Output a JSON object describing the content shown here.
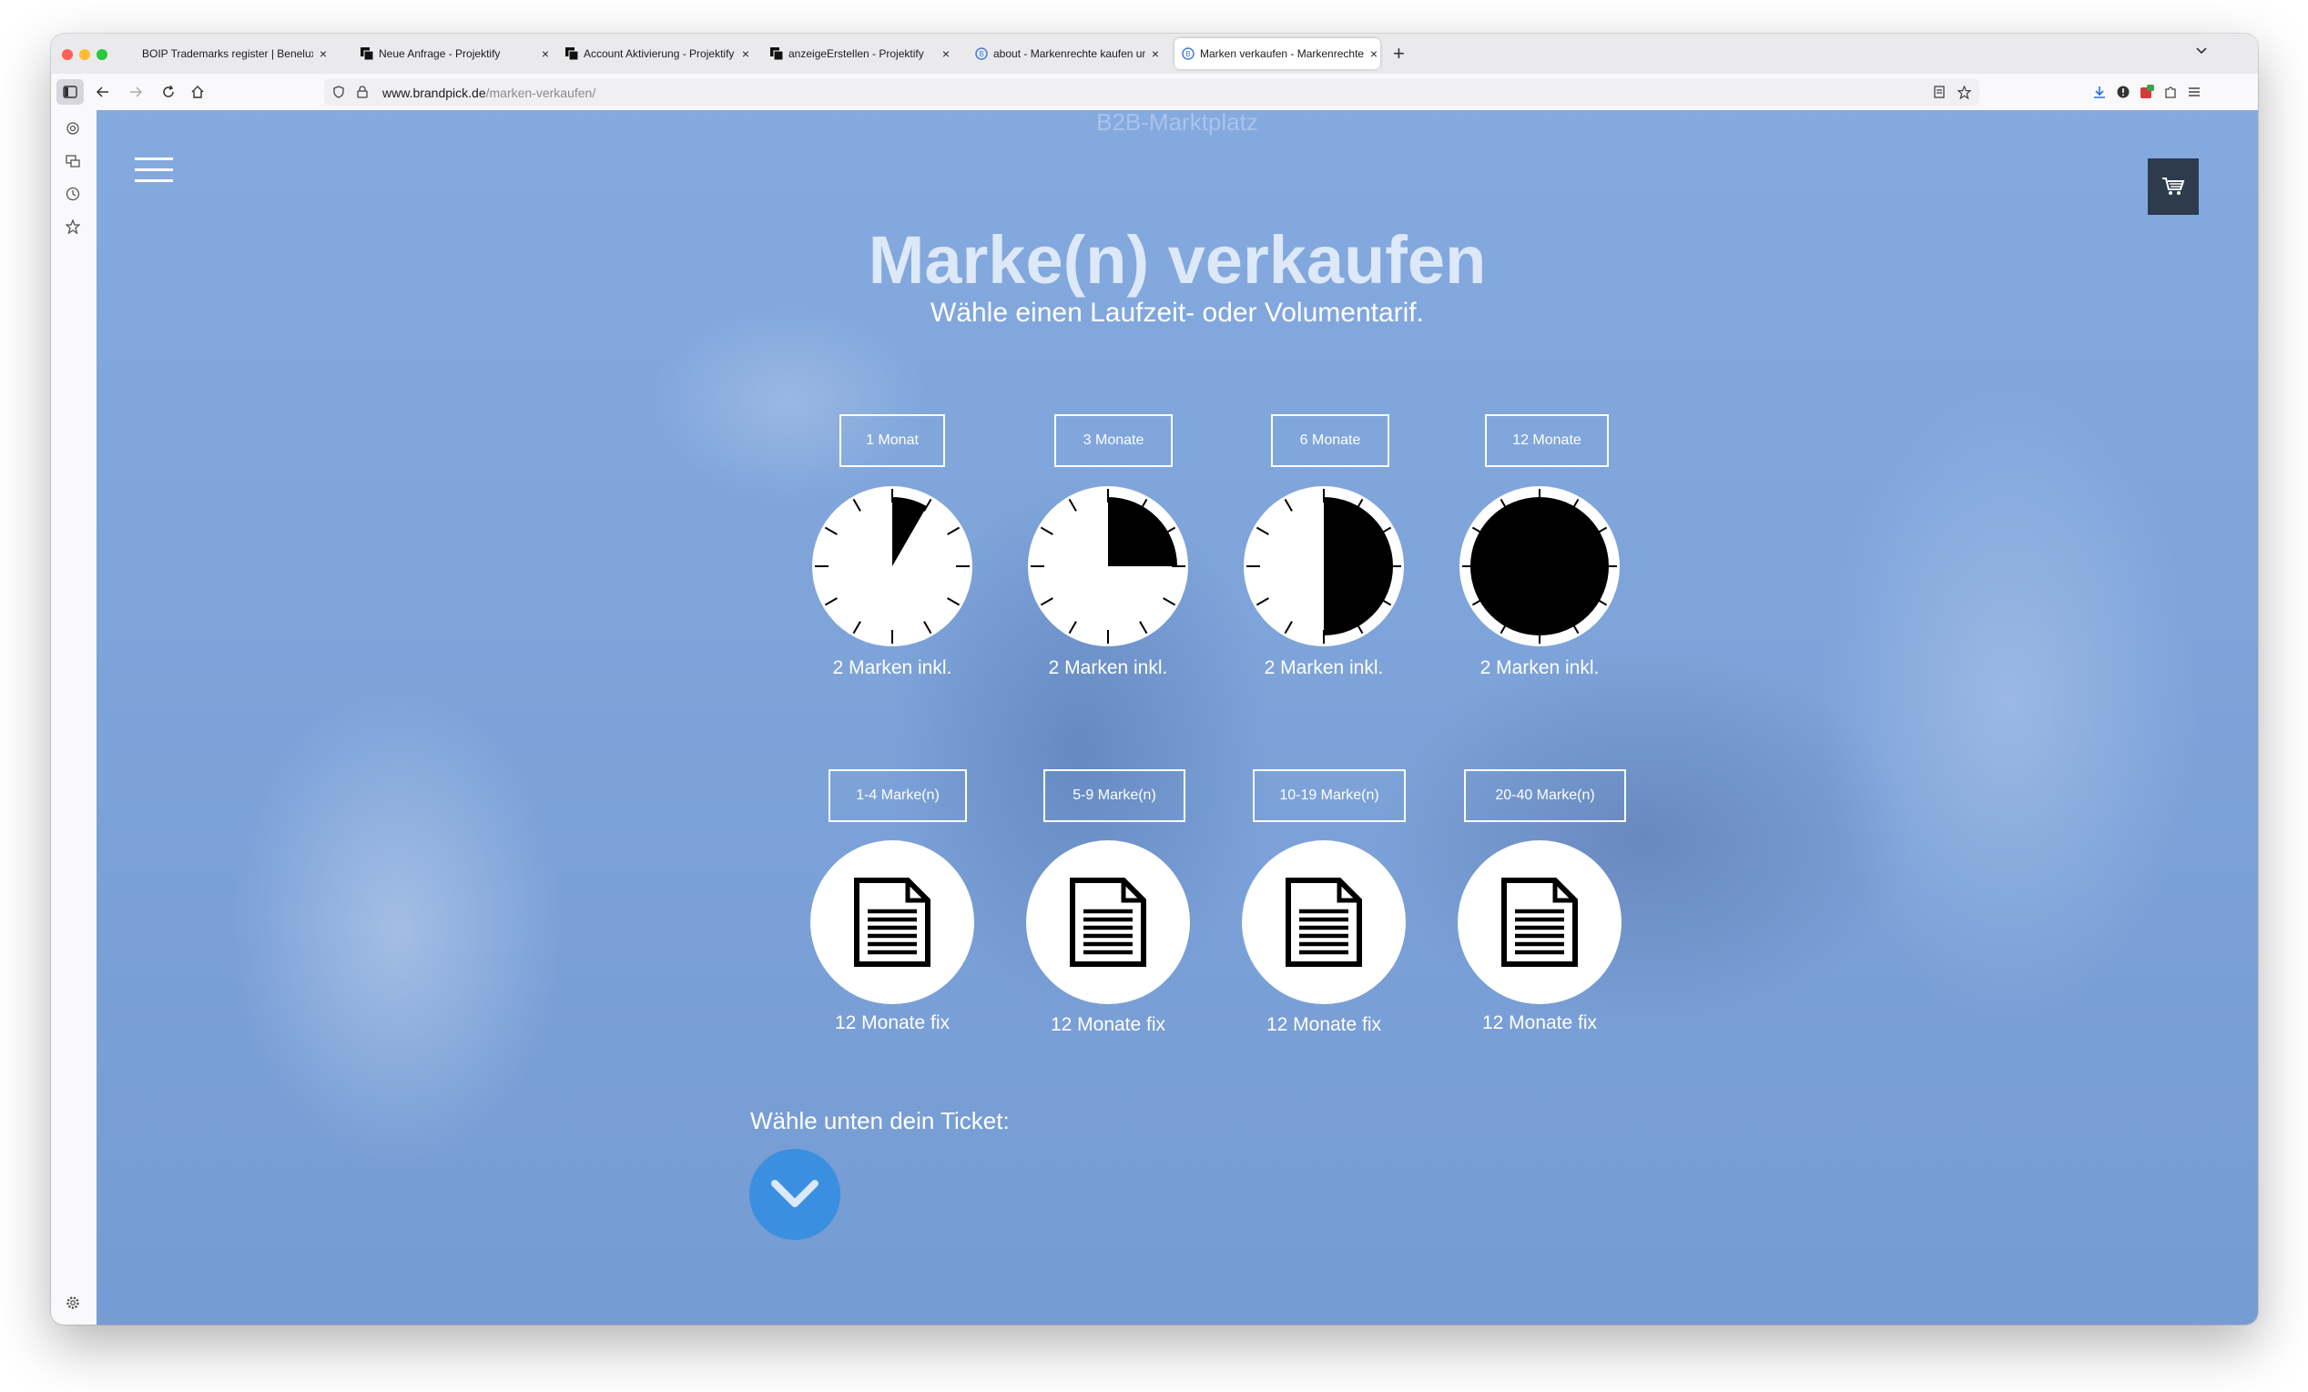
{
  "browser": {
    "tabs": [
      {
        "title": "BOIP Trademarks register | Benelux",
        "active": false
      },
      {
        "title": "Neue Anfrage - Projektify",
        "active": false
      },
      {
        "title": "Account Aktivierung - Projektify",
        "active": false
      },
      {
        "title": "anzeigeErstellen - Projektify",
        "active": false
      },
      {
        "title": "about - Markenrechte kaufen und",
        "active": false
      },
      {
        "title": "Marken verkaufen - Markenrechte",
        "active": true
      }
    ],
    "url_domain": "www.brandpick.de",
    "url_path": "/marken-verkaufen/"
  },
  "page": {
    "header_text": "B2B-Marktplatz",
    "title": "Marke(n) verkaufen",
    "subtitle": "Wähle einen Laufzeit- oder Volumentarif.",
    "duration_plans": [
      {
        "label": "1 Monat",
        "caption": "2 Marken inkl.",
        "fill_fraction": 0.0833
      },
      {
        "label": "3 Monate",
        "caption": "2 Marken inkl.",
        "fill_fraction": 0.25
      },
      {
        "label": "6 Monate",
        "caption": "2 Marken inkl.",
        "fill_fraction": 0.5
      },
      {
        "label": "12 Monate",
        "caption": "2 Marken inkl.",
        "fill_fraction": 1.0
      }
    ],
    "volume_plans": [
      {
        "label": "1-4 Marke(n)",
        "caption": "12 Monate fix"
      },
      {
        "label": "5-9 Marke(n)",
        "caption": "12 Monate fix"
      },
      {
        "label": "10-19 Marke(n)",
        "caption": "12 Monate fix"
      },
      {
        "label": "20-40 Marke(n)",
        "caption": "12 Monate fix"
      }
    ],
    "ticket_prompt": "Wähle unten dein Ticket:"
  },
  "colors": {
    "overlay_blue": "#7ea6dc",
    "cart_button": "#2d3b4d",
    "down_button": "#3a8fe0"
  }
}
